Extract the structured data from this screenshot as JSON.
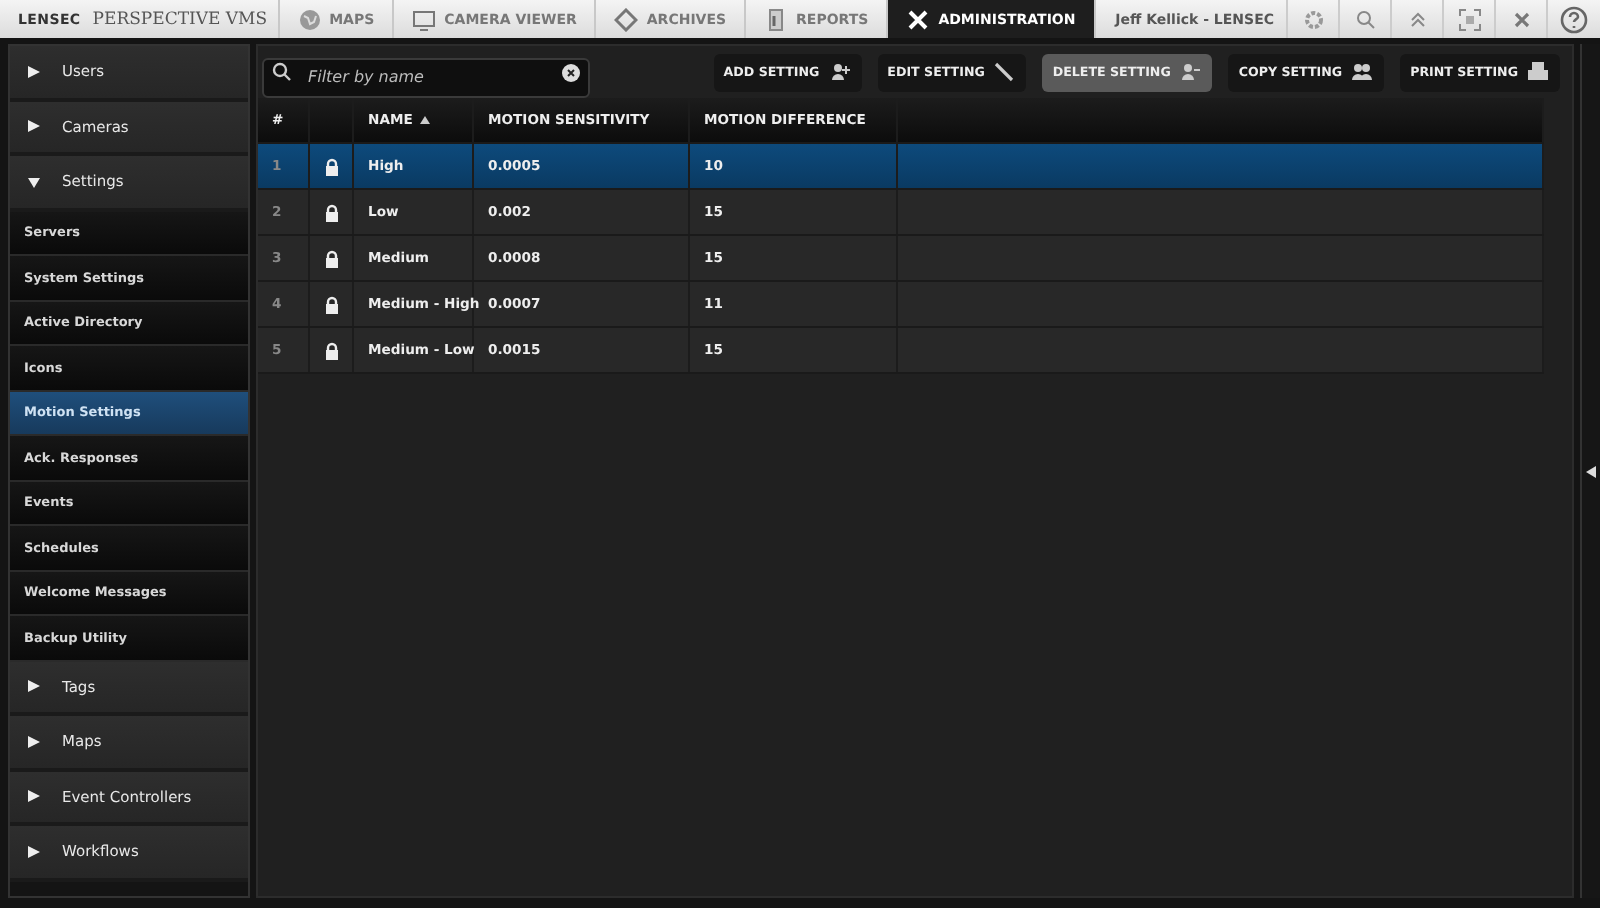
{
  "top_bar": {
    "logo": "LENSEC",
    "product": "PERSPECTIVE VMS",
    "tabs": [
      {
        "label": "MAPS",
        "selected": false
      },
      {
        "label": "CAMERA VIEWER",
        "selected": false
      },
      {
        "label": "ARCHIVES",
        "selected": false
      },
      {
        "label": "REPORTS",
        "selected": false
      },
      {
        "label": "ADMINISTRATION",
        "selected": true
      }
    ],
    "user": "Jeff Kellick - LENSEC"
  },
  "sidebar": {
    "groups": [
      {
        "label": "Users",
        "expanded": false
      },
      {
        "label": "Cameras",
        "expanded": false
      },
      {
        "label": "Settings",
        "expanded": true,
        "children": [
          {
            "label": "Servers",
            "selected": false
          },
          {
            "label": "System Settings",
            "selected": false
          },
          {
            "label": "Active Directory",
            "selected": false
          },
          {
            "label": "Icons",
            "selected": false
          },
          {
            "label": "Motion Settings",
            "selected": true
          },
          {
            "label": "Ack. Responses",
            "selected": false
          },
          {
            "label": "Events",
            "selected": false
          },
          {
            "label": "Schedules",
            "selected": false
          },
          {
            "label": "Welcome Messages",
            "selected": false
          },
          {
            "label": "Backup Utility",
            "selected": false
          }
        ]
      },
      {
        "label": "Tags",
        "expanded": false
      },
      {
        "label": "Maps",
        "expanded": false
      },
      {
        "label": "Event Controllers",
        "expanded": false
      },
      {
        "label": "Workflows",
        "expanded": false
      }
    ]
  },
  "filter": {
    "placeholder": "Filter by name"
  },
  "actions": [
    {
      "label": "ADD SETTING",
      "highlighted": false
    },
    {
      "label": "EDIT SETTING",
      "highlighted": false
    },
    {
      "label": "DELETE SETTING",
      "highlighted": true
    },
    {
      "label": "COPY SETTING",
      "highlighted": false
    },
    {
      "label": "PRINT SETTING",
      "highlighted": false
    }
  ],
  "table": {
    "columns": [
      {
        "label": "#",
        "sorted": false
      },
      {
        "sorted": false
      },
      {
        "label": "NAME",
        "sorted": true
      },
      {
        "label": "MOTION SENSITIVITY",
        "sorted": false
      },
      {
        "label": "MOTION DIFFERENCE",
        "sorted": false
      }
    ],
    "rows": [
      {
        "index": "1",
        "locked": true,
        "name": "High",
        "sensitivity": "0.0005",
        "difference": "10",
        "selected": true
      },
      {
        "index": "2",
        "locked": true,
        "name": "Low",
        "sensitivity": "0.002",
        "difference": "15",
        "selected": false
      },
      {
        "index": "3",
        "locked": true,
        "name": "Medium",
        "sensitivity": "0.0008",
        "difference": "15",
        "selected": false
      },
      {
        "index": "4",
        "locked": true,
        "name": "Medium - High",
        "sensitivity": "0.0007",
        "difference": "11",
        "selected": false
      },
      {
        "index": "5",
        "locked": true,
        "name": "Medium - Low",
        "sensitivity": "0.0015",
        "difference": "15",
        "selected": false
      }
    ]
  }
}
